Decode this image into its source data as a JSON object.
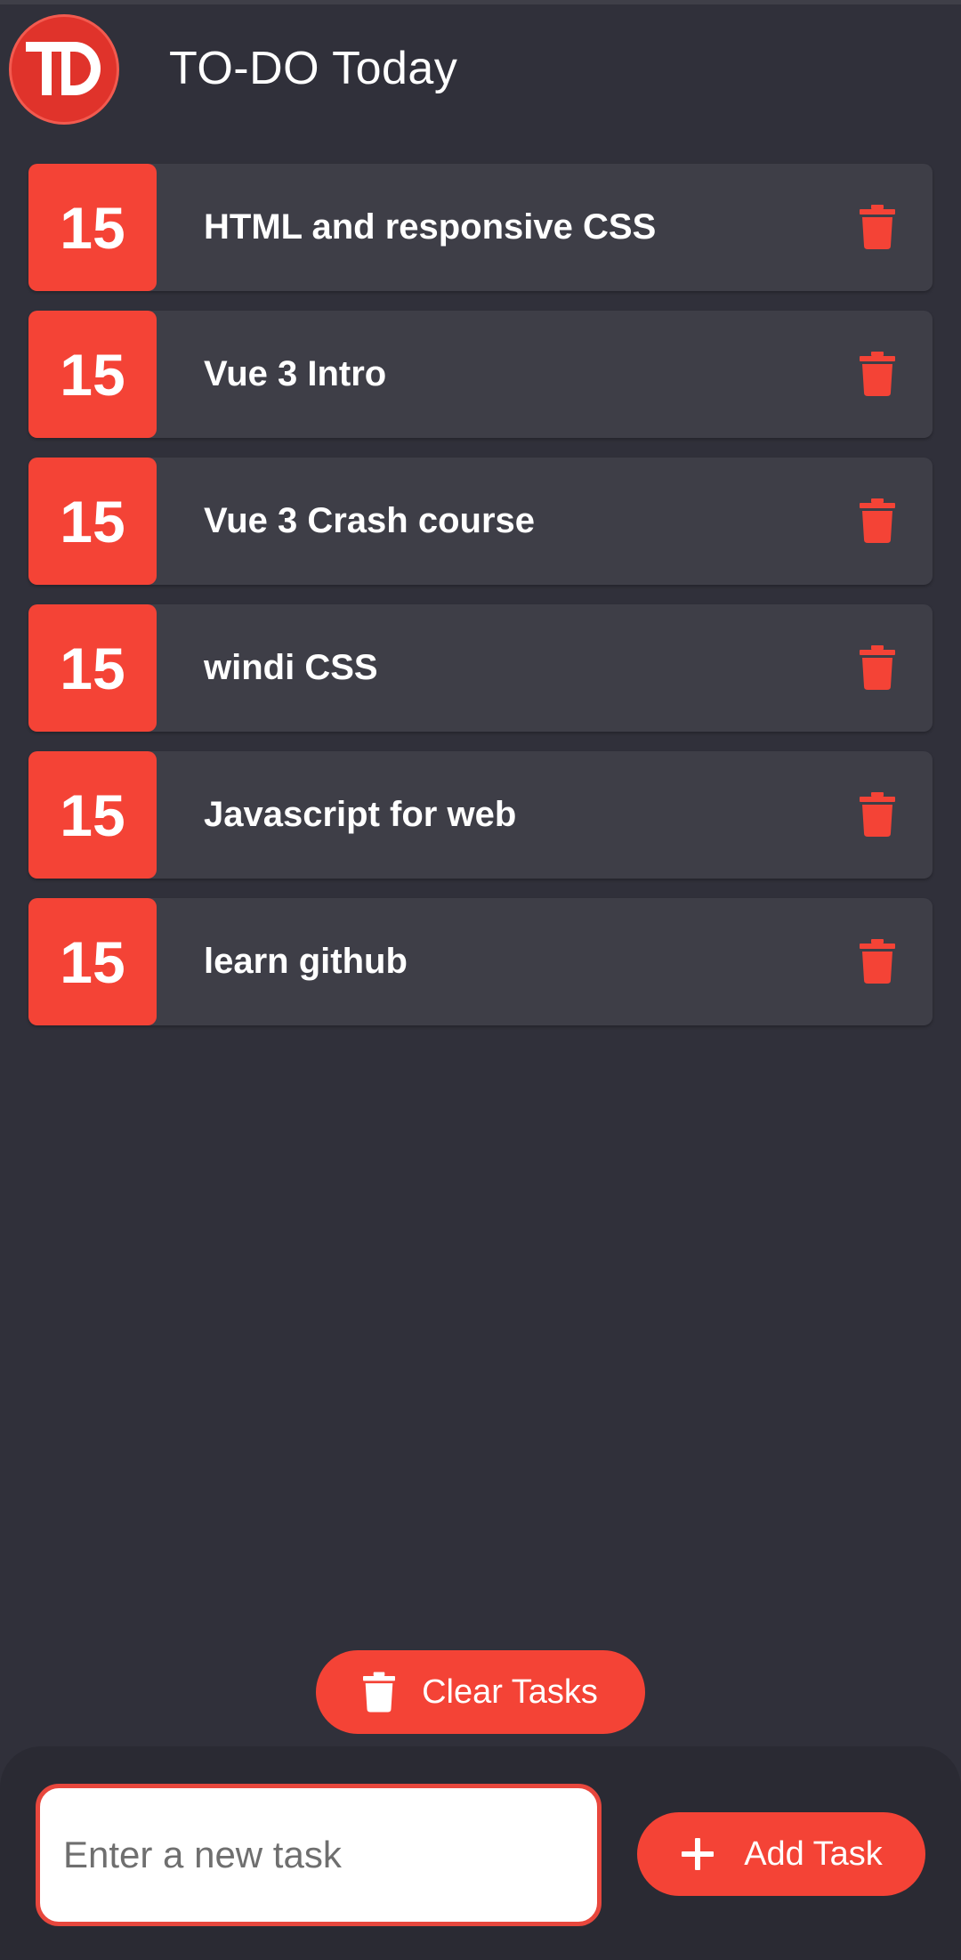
{
  "header": {
    "logo_text": "TD",
    "title": "TO-DO Today"
  },
  "tasks": [
    {
      "badge": "15",
      "text": "HTML and responsive CSS",
      "delete_icon": "trash-icon"
    },
    {
      "badge": "15",
      "text": "Vue 3 Intro",
      "delete_icon": "trash-icon"
    },
    {
      "badge": "15",
      "text": "Vue 3 Crash course",
      "delete_icon": "trash-icon"
    },
    {
      "badge": "15",
      "text": "windi CSS",
      "delete_icon": "trash-icon"
    },
    {
      "badge": "15",
      "text": "Javascript for web",
      "delete_icon": "trash-icon"
    },
    {
      "badge": "15",
      "text": "learn github",
      "delete_icon": "trash-icon"
    }
  ],
  "actions": {
    "clear_label": "Clear Tasks",
    "clear_icon": "trash-icon"
  },
  "footer": {
    "input_placeholder": "Enter a new task",
    "input_value": "",
    "add_label": "Add Task",
    "add_icon": "plus-icon"
  },
  "colors": {
    "background": "#30303a",
    "card": "#3e3e47",
    "accent": "#f44336",
    "footer": "#2a2a33"
  }
}
